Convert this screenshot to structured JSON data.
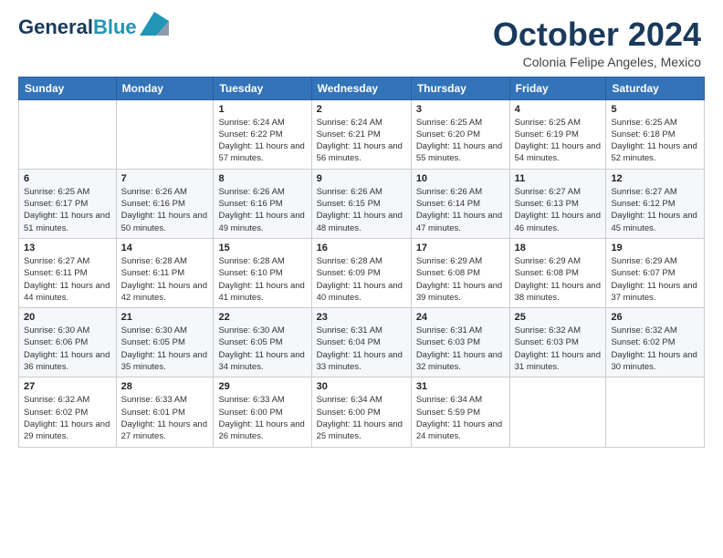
{
  "header": {
    "logo_line1": "General",
    "logo_line2": "Blue",
    "month_title": "October 2024",
    "location": "Colonia Felipe Angeles, Mexico"
  },
  "days_of_week": [
    "Sunday",
    "Monday",
    "Tuesday",
    "Wednesday",
    "Thursday",
    "Friday",
    "Saturday"
  ],
  "weeks": [
    [
      {
        "day": "",
        "info": ""
      },
      {
        "day": "",
        "info": ""
      },
      {
        "day": "1",
        "info": "Sunrise: 6:24 AM\nSunset: 6:22 PM\nDaylight: 11 hours and 57 minutes."
      },
      {
        "day": "2",
        "info": "Sunrise: 6:24 AM\nSunset: 6:21 PM\nDaylight: 11 hours and 56 minutes."
      },
      {
        "day": "3",
        "info": "Sunrise: 6:25 AM\nSunset: 6:20 PM\nDaylight: 11 hours and 55 minutes."
      },
      {
        "day": "4",
        "info": "Sunrise: 6:25 AM\nSunset: 6:19 PM\nDaylight: 11 hours and 54 minutes."
      },
      {
        "day": "5",
        "info": "Sunrise: 6:25 AM\nSunset: 6:18 PM\nDaylight: 11 hours and 52 minutes."
      }
    ],
    [
      {
        "day": "6",
        "info": "Sunrise: 6:25 AM\nSunset: 6:17 PM\nDaylight: 11 hours and 51 minutes."
      },
      {
        "day": "7",
        "info": "Sunrise: 6:26 AM\nSunset: 6:16 PM\nDaylight: 11 hours and 50 minutes."
      },
      {
        "day": "8",
        "info": "Sunrise: 6:26 AM\nSunset: 6:16 PM\nDaylight: 11 hours and 49 minutes."
      },
      {
        "day": "9",
        "info": "Sunrise: 6:26 AM\nSunset: 6:15 PM\nDaylight: 11 hours and 48 minutes."
      },
      {
        "day": "10",
        "info": "Sunrise: 6:26 AM\nSunset: 6:14 PM\nDaylight: 11 hours and 47 minutes."
      },
      {
        "day": "11",
        "info": "Sunrise: 6:27 AM\nSunset: 6:13 PM\nDaylight: 11 hours and 46 minutes."
      },
      {
        "day": "12",
        "info": "Sunrise: 6:27 AM\nSunset: 6:12 PM\nDaylight: 11 hours and 45 minutes."
      }
    ],
    [
      {
        "day": "13",
        "info": "Sunrise: 6:27 AM\nSunset: 6:11 PM\nDaylight: 11 hours and 44 minutes."
      },
      {
        "day": "14",
        "info": "Sunrise: 6:28 AM\nSunset: 6:11 PM\nDaylight: 11 hours and 42 minutes."
      },
      {
        "day": "15",
        "info": "Sunrise: 6:28 AM\nSunset: 6:10 PM\nDaylight: 11 hours and 41 minutes."
      },
      {
        "day": "16",
        "info": "Sunrise: 6:28 AM\nSunset: 6:09 PM\nDaylight: 11 hours and 40 minutes."
      },
      {
        "day": "17",
        "info": "Sunrise: 6:29 AM\nSunset: 6:08 PM\nDaylight: 11 hours and 39 minutes."
      },
      {
        "day": "18",
        "info": "Sunrise: 6:29 AM\nSunset: 6:08 PM\nDaylight: 11 hours and 38 minutes."
      },
      {
        "day": "19",
        "info": "Sunrise: 6:29 AM\nSunset: 6:07 PM\nDaylight: 11 hours and 37 minutes."
      }
    ],
    [
      {
        "day": "20",
        "info": "Sunrise: 6:30 AM\nSunset: 6:06 PM\nDaylight: 11 hours and 36 minutes."
      },
      {
        "day": "21",
        "info": "Sunrise: 6:30 AM\nSunset: 6:05 PM\nDaylight: 11 hours and 35 minutes."
      },
      {
        "day": "22",
        "info": "Sunrise: 6:30 AM\nSunset: 6:05 PM\nDaylight: 11 hours and 34 minutes."
      },
      {
        "day": "23",
        "info": "Sunrise: 6:31 AM\nSunset: 6:04 PM\nDaylight: 11 hours and 33 minutes."
      },
      {
        "day": "24",
        "info": "Sunrise: 6:31 AM\nSunset: 6:03 PM\nDaylight: 11 hours and 32 minutes."
      },
      {
        "day": "25",
        "info": "Sunrise: 6:32 AM\nSunset: 6:03 PM\nDaylight: 11 hours and 31 minutes."
      },
      {
        "day": "26",
        "info": "Sunrise: 6:32 AM\nSunset: 6:02 PM\nDaylight: 11 hours and 30 minutes."
      }
    ],
    [
      {
        "day": "27",
        "info": "Sunrise: 6:32 AM\nSunset: 6:02 PM\nDaylight: 11 hours and 29 minutes."
      },
      {
        "day": "28",
        "info": "Sunrise: 6:33 AM\nSunset: 6:01 PM\nDaylight: 11 hours and 27 minutes."
      },
      {
        "day": "29",
        "info": "Sunrise: 6:33 AM\nSunset: 6:00 PM\nDaylight: 11 hours and 26 minutes."
      },
      {
        "day": "30",
        "info": "Sunrise: 6:34 AM\nSunset: 6:00 PM\nDaylight: 11 hours and 25 minutes."
      },
      {
        "day": "31",
        "info": "Sunrise: 6:34 AM\nSunset: 5:59 PM\nDaylight: 11 hours and 24 minutes."
      },
      {
        "day": "",
        "info": ""
      },
      {
        "day": "",
        "info": ""
      }
    ]
  ]
}
